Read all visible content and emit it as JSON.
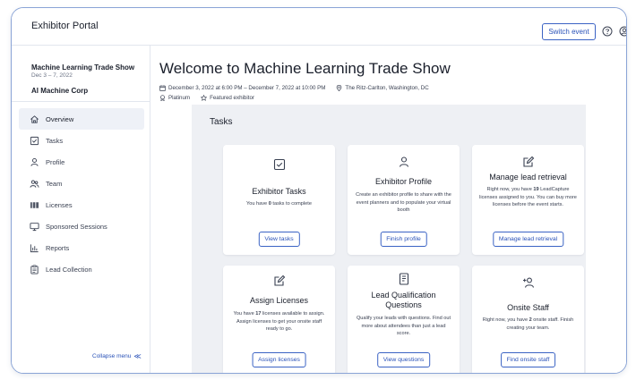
{
  "header": {
    "portal_title": "Exhibitor Portal",
    "switch_event_label": "Switch event"
  },
  "sidebar": {
    "event_name": "Machine Learning Trade Show",
    "event_dates": "Dec 3 – 7, 2022",
    "company": "AI Machine Corp",
    "items": [
      {
        "label": "Overview",
        "icon": "home-icon",
        "active": true
      },
      {
        "label": "Tasks",
        "icon": "checkbox-icon"
      },
      {
        "label": "Profile",
        "icon": "person-icon"
      },
      {
        "label": "Team",
        "icon": "people-icon"
      },
      {
        "label": "Licenses",
        "icon": "barcode-icon"
      },
      {
        "label": "Sponsored Sessions",
        "icon": "monitor-icon"
      },
      {
        "label": "Reports",
        "icon": "bar-chart-icon"
      },
      {
        "label": "Lead Collection",
        "icon": "clipboard-icon"
      }
    ],
    "collapse_label": "Collapse menu",
    "collapse_glyph": "≪"
  },
  "main": {
    "title": "Welcome to Machine Learning Trade Show",
    "date_range": "December 3, 2022 at 6:00 PM – December 7, 2022 at 10:00 PM",
    "venue": "The Ritz-Carlton, Washington, DC",
    "tier": "Platinum",
    "featured": "Featured exhibitor",
    "tasks_heading": "Tasks"
  },
  "cards": [
    {
      "icon": "checkbox-icon",
      "title": "Exhibitor Tasks",
      "desc_pre": "You have ",
      "desc_num": "0",
      "desc_post": " tasks to complete",
      "button": "View tasks"
    },
    {
      "icon": "person-icon",
      "title": "Exhibitor Profile",
      "desc_pre": "Create an exhibitor profile to share with the event planners and to populate your virtual booth",
      "desc_num": "",
      "desc_post": "",
      "button": "Finish profile"
    },
    {
      "icon": "edit-icon",
      "title": "Manage lead retrieval",
      "desc_pre": "Right now, you have ",
      "desc_num": "19",
      "desc_post": " LeadCapture licenses assigned to you. You can buy more licenses before the event starts.",
      "button": "Manage lead retrieval"
    },
    {
      "icon": "edit-icon",
      "title": "Assign Licenses",
      "desc_pre": "You have ",
      "desc_num": "17",
      "desc_post": " licenses available to assign. Assign licenses to get your onsite staff ready to go.",
      "button": "Assign licenses"
    },
    {
      "icon": "document-icon",
      "title": "Lead Qualification Questions",
      "desc_pre": "Qualify your leads with questions. Find out more about attendees than just a lead score.",
      "desc_num": "",
      "desc_post": "",
      "button": "View questions"
    },
    {
      "icon": "add-person-icon",
      "title": "Onsite Staff",
      "desc_pre": "Right now, you have ",
      "desc_num": "2",
      "desc_post": " onsite staff. Finish creating your team.",
      "button": "Find onsite staff"
    }
  ],
  "colors": {
    "accent": "#2a52b8",
    "panel_bg": "#eef0f4",
    "frame_border": "#8aa4d6"
  }
}
